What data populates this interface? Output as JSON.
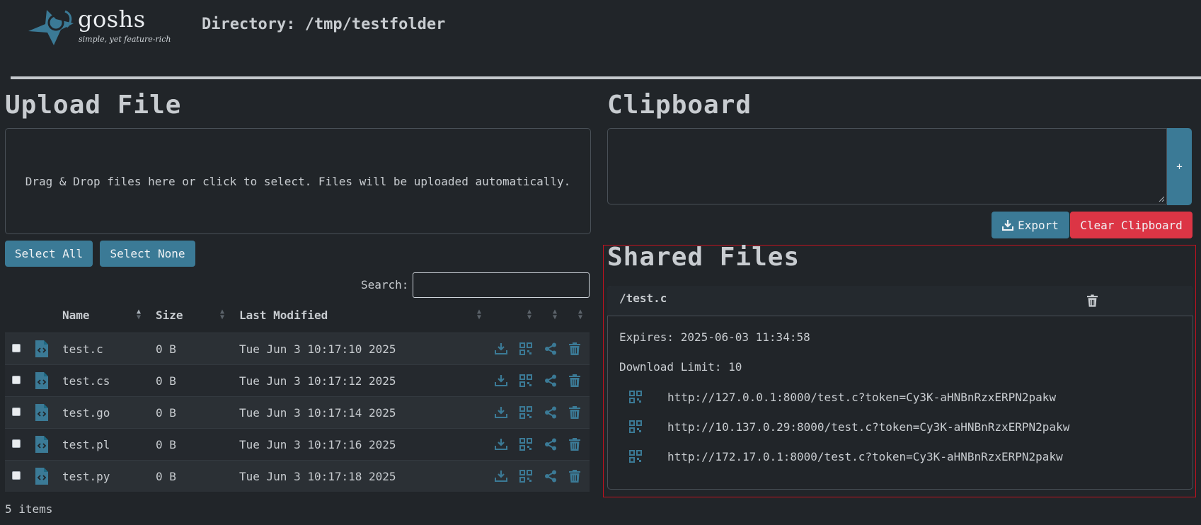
{
  "header": {
    "logo_name": "goshs",
    "logo_tagline": "simple, yet feature-rich",
    "directory_title": "Directory: /tmp/testfolder"
  },
  "upload": {
    "title": "Upload File",
    "dropzone_text": "Drag & Drop files here or click to select. Files will be uploaded automatically.",
    "select_all": "Select All",
    "select_none": "Select None",
    "search_label": "Search:",
    "search_value": ""
  },
  "table": {
    "columns": [
      "Name",
      "Size",
      "Last Modified"
    ],
    "rows": [
      {
        "name": "test.c",
        "size": "0 B",
        "modified": "Tue Jun 3 10:17:10 2025"
      },
      {
        "name": "test.cs",
        "size": "0 B",
        "modified": "Tue Jun 3 10:17:12 2025"
      },
      {
        "name": "test.go",
        "size": "0 B",
        "modified": "Tue Jun 3 10:17:14 2025"
      },
      {
        "name": "test.pl",
        "size": "0 B",
        "modified": "Tue Jun 3 10:17:16 2025"
      },
      {
        "name": "test.py",
        "size": "0 B",
        "modified": "Tue Jun 3 10:17:18 2025"
      }
    ],
    "row_icons": [
      "file-code-icon",
      "download-icon",
      "qr-code-icon",
      "share-icon",
      "trash-icon"
    ],
    "items_count": "5 items"
  },
  "clipboard": {
    "title": "Clipboard",
    "value": "",
    "add_label": "+",
    "export_label": "Export",
    "clear_label": "Clear Clipboard"
  },
  "shared": {
    "title": "Shared Files",
    "file": "/test.c",
    "expires": "Expires: 2025-06-03 11:34:58",
    "download_limit": "Download Limit: 10",
    "links": [
      "http://127.0.0.1:8000/test.c?token=Cy3K-aHNBnRzxERPN2pakw",
      "http://10.137.0.29:8000/test.c?token=Cy3K-aHNBnRzxERPN2pakw",
      "http://172.17.0.1:8000/test.c?token=Cy3K-aHNBnRzxERPN2pakw"
    ]
  },
  "colors": {
    "background": "#212529",
    "accent": "#3b7a96",
    "danger": "#dc3545",
    "highlight_border": "#c1121f"
  }
}
